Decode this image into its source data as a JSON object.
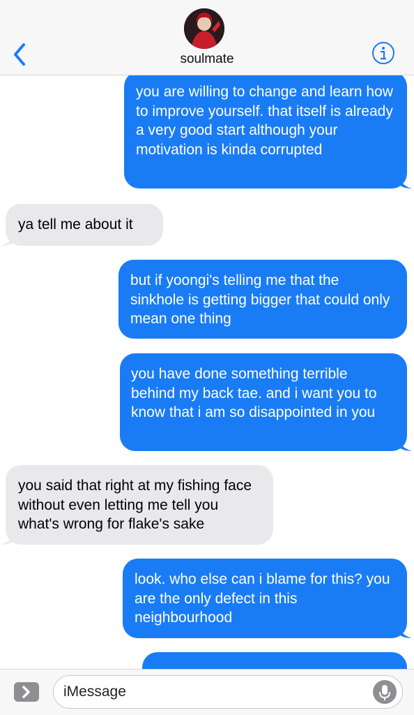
{
  "header": {
    "contact_name": "soulmate"
  },
  "messages": [
    {
      "direction": "out",
      "text": "you are willing to change and learn how to improve yourself. that itself is already a very good start although your motivation is kinda corrupted"
    },
    {
      "direction": "in",
      "text": "ya tell me about it"
    },
    {
      "direction": "out",
      "text": "but if yoongi's telling me that the sinkhole is getting bigger that could only mean one thing"
    },
    {
      "direction": "out",
      "text": "you have done something terrible behind my back tae. and i want you to know that i am so disappointed in you"
    },
    {
      "direction": "in",
      "text": "you said that right at my fishing face without even letting me tell you what's wrong for flake's sake"
    },
    {
      "direction": "out",
      "text": "look. who else can i blame for this? you are the only defect in this neighbourhood"
    }
  ],
  "input": {
    "placeholder": "iMessage"
  },
  "colors": {
    "outgoing_bubble": "#1a7cf5",
    "incoming_bubble": "#e9e9eb",
    "accent": "#1a7cf5"
  },
  "icons": [
    "chevron-left-icon",
    "info-icon",
    "app-drawer-icon",
    "microphone-icon"
  ]
}
